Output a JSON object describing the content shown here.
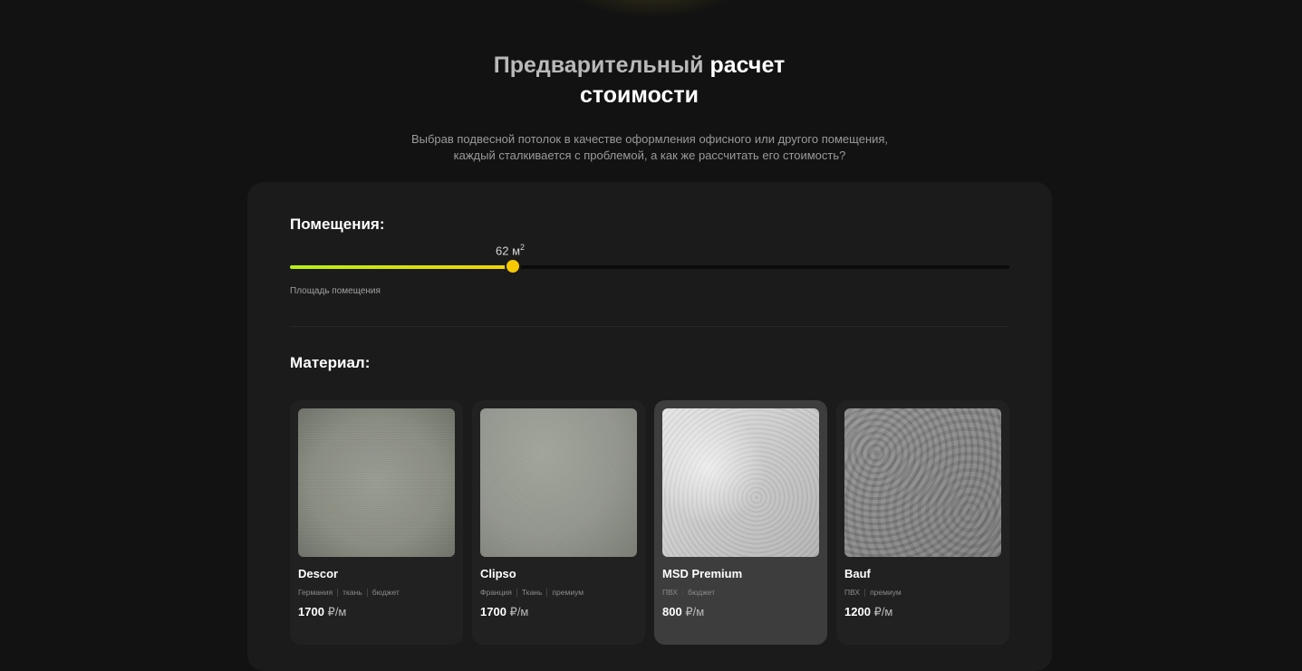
{
  "header": {
    "title_part1": "Предварительный",
    "title_part2": "расчет",
    "title_line2": "стоимости",
    "subtitle_line1": "Выбрав подвесной потолок в качестве оформления офисного или другого помещения,",
    "subtitle_line2": "каждый сталкивается с проблемой, а как же рассчитать его стоимость?"
  },
  "rooms": {
    "label": "Помещения:",
    "area_value": "62 м",
    "area_unit_exp": "2",
    "area_fraction": 0.31,
    "caption": "Площадь помещения"
  },
  "material": {
    "label": "Материал:",
    "items": [
      {
        "name": "Descor",
        "tags": [
          "Германия",
          "ткань",
          "бюджет"
        ],
        "price": "1700",
        "unit": "₽/м",
        "selected": false
      },
      {
        "name": "Clipso",
        "tags": [
          "Франция",
          "Ткань",
          "премиум"
        ],
        "price": "1700",
        "unit": "₽/м",
        "selected": false
      },
      {
        "name": "MSD Premium",
        "tags": [
          "ПВХ",
          "бюджет"
        ],
        "price": "800",
        "unit": "₽/м",
        "selected": true
      },
      {
        "name": "Bauf",
        "tags": [
          "ПВХ",
          "премиум"
        ],
        "price": "1200",
        "unit": "₽/м",
        "selected": false
      }
    ]
  },
  "colors": {
    "accent_start": "#b7f012",
    "accent_end": "#f3d400",
    "thumb": "#f5c800"
  }
}
